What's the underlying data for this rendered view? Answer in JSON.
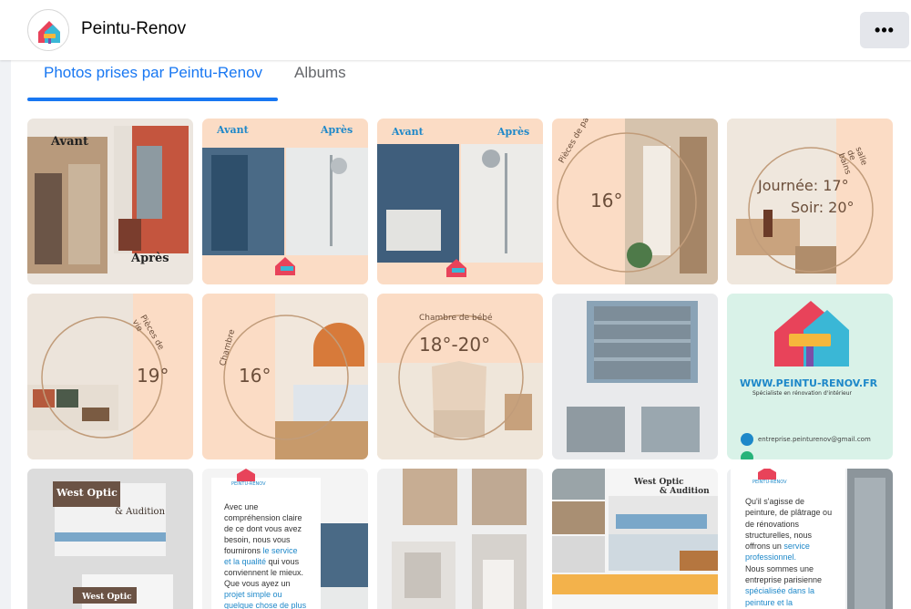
{
  "page": {
    "name": "Peintu-Renov"
  },
  "tabs": [
    {
      "label": "Photos prises par Peintu-Renov",
      "active": true
    },
    {
      "label": "Albums",
      "active": false
    }
  ],
  "colors": {
    "accent": "#1877f2",
    "muted": "#65676b",
    "peach": "#fbdcc5"
  },
  "photos": {
    "p1": {
      "before": "Avant",
      "after": "Après"
    },
    "p2": {
      "before": "Avant",
      "after": "Après"
    },
    "p3": {
      "before": "Avant",
      "after": "Après"
    },
    "p4": {
      "arc": "Pièces de passage",
      "temp": "16°"
    },
    "p5": {
      "arc": "salle de bains",
      "day": "Journée: 17°",
      "night": "Soir: 20°"
    },
    "p6": {
      "arc": "Pièces de vie",
      "temp": "19°"
    },
    "p7": {
      "arc": "Chambre",
      "temp": "16°"
    },
    "p8": {
      "arc": "Chambre de bébé",
      "temp": "18°-20°"
    },
    "p10": {
      "site": "WWW.PEINTU-RENOV.FR",
      "tagline": "Spécialiste en rénovation d'intérieur",
      "email": "entreprise.peinturenov@gmail.com"
    },
    "p11": {
      "sign1": "West Optic",
      "sign2": "& Audition",
      "sign3": "West Optic"
    },
    "p12": {
      "brand": "PEINTU-RENOV",
      "t1": "Avec une",
      "t2": "compréhension claire",
      "t3": "de ce dont vous avez",
      "t4": "besoin, nous vous",
      "t5a": "fournirons ",
      "t5b": "le service",
      "t6": "et la qualité",
      "t6b": " qui vous",
      "t7": "conviennent le mieux.",
      "t8": "Que vous ayez un",
      "t9": "projet simple ou",
      "t10": "quelque chose de plus"
    },
    "p14": {
      "sign1": "West Optic",
      "sign2": "& Audition"
    },
    "p15": {
      "brand": "PEINTU-RENOV",
      "t1": "Qu'il s'agisse de",
      "t2": "peinture, de plâtrage ou",
      "t3": "de rénovations",
      "t4": "structurelles, nous",
      "t5a": "offrons un ",
      "t5b": "service",
      "t6": "professionnel.",
      "t7": "Nous sommes une",
      "t8": "entreprise parisienne",
      "t9": "spécialisée dans la",
      "t10": "peinture et la"
    }
  }
}
